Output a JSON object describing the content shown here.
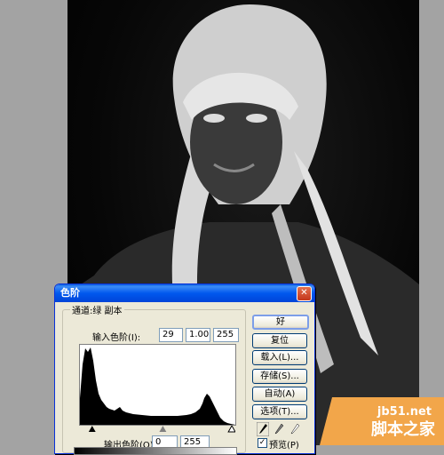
{
  "dialog": {
    "title": "色阶",
    "close_glyph": "✕",
    "channel_label": "通道:绿 副本",
    "input_levels_label": "输入色阶(I):",
    "input_black": "29",
    "input_gamma": "1.00",
    "input_white": "255",
    "output_levels_label": "输出色阶(O):",
    "output_black": "0",
    "output_white": "255",
    "buttons": {
      "ok": "好",
      "reset": "复位",
      "load": "载入(L)...",
      "save": "存储(S)...",
      "auto": "自动(A)",
      "options": "选项(T)..."
    },
    "preview_label": "预览(P)",
    "preview_checked": true
  },
  "icons": {
    "black_eyedropper": "eyedropper-black-icon",
    "gray_eyedropper": "eyedropper-gray-icon",
    "white_eyedropper": "eyedropper-white-icon",
    "close": "close-icon"
  },
  "watermark": {
    "url": "jb51.net",
    "text": "脚本之家"
  },
  "colors": {
    "title_blue": "#0058ee",
    "dialog_bg": "#ece9d8",
    "workspace_gray": "#a3a3a3"
  }
}
